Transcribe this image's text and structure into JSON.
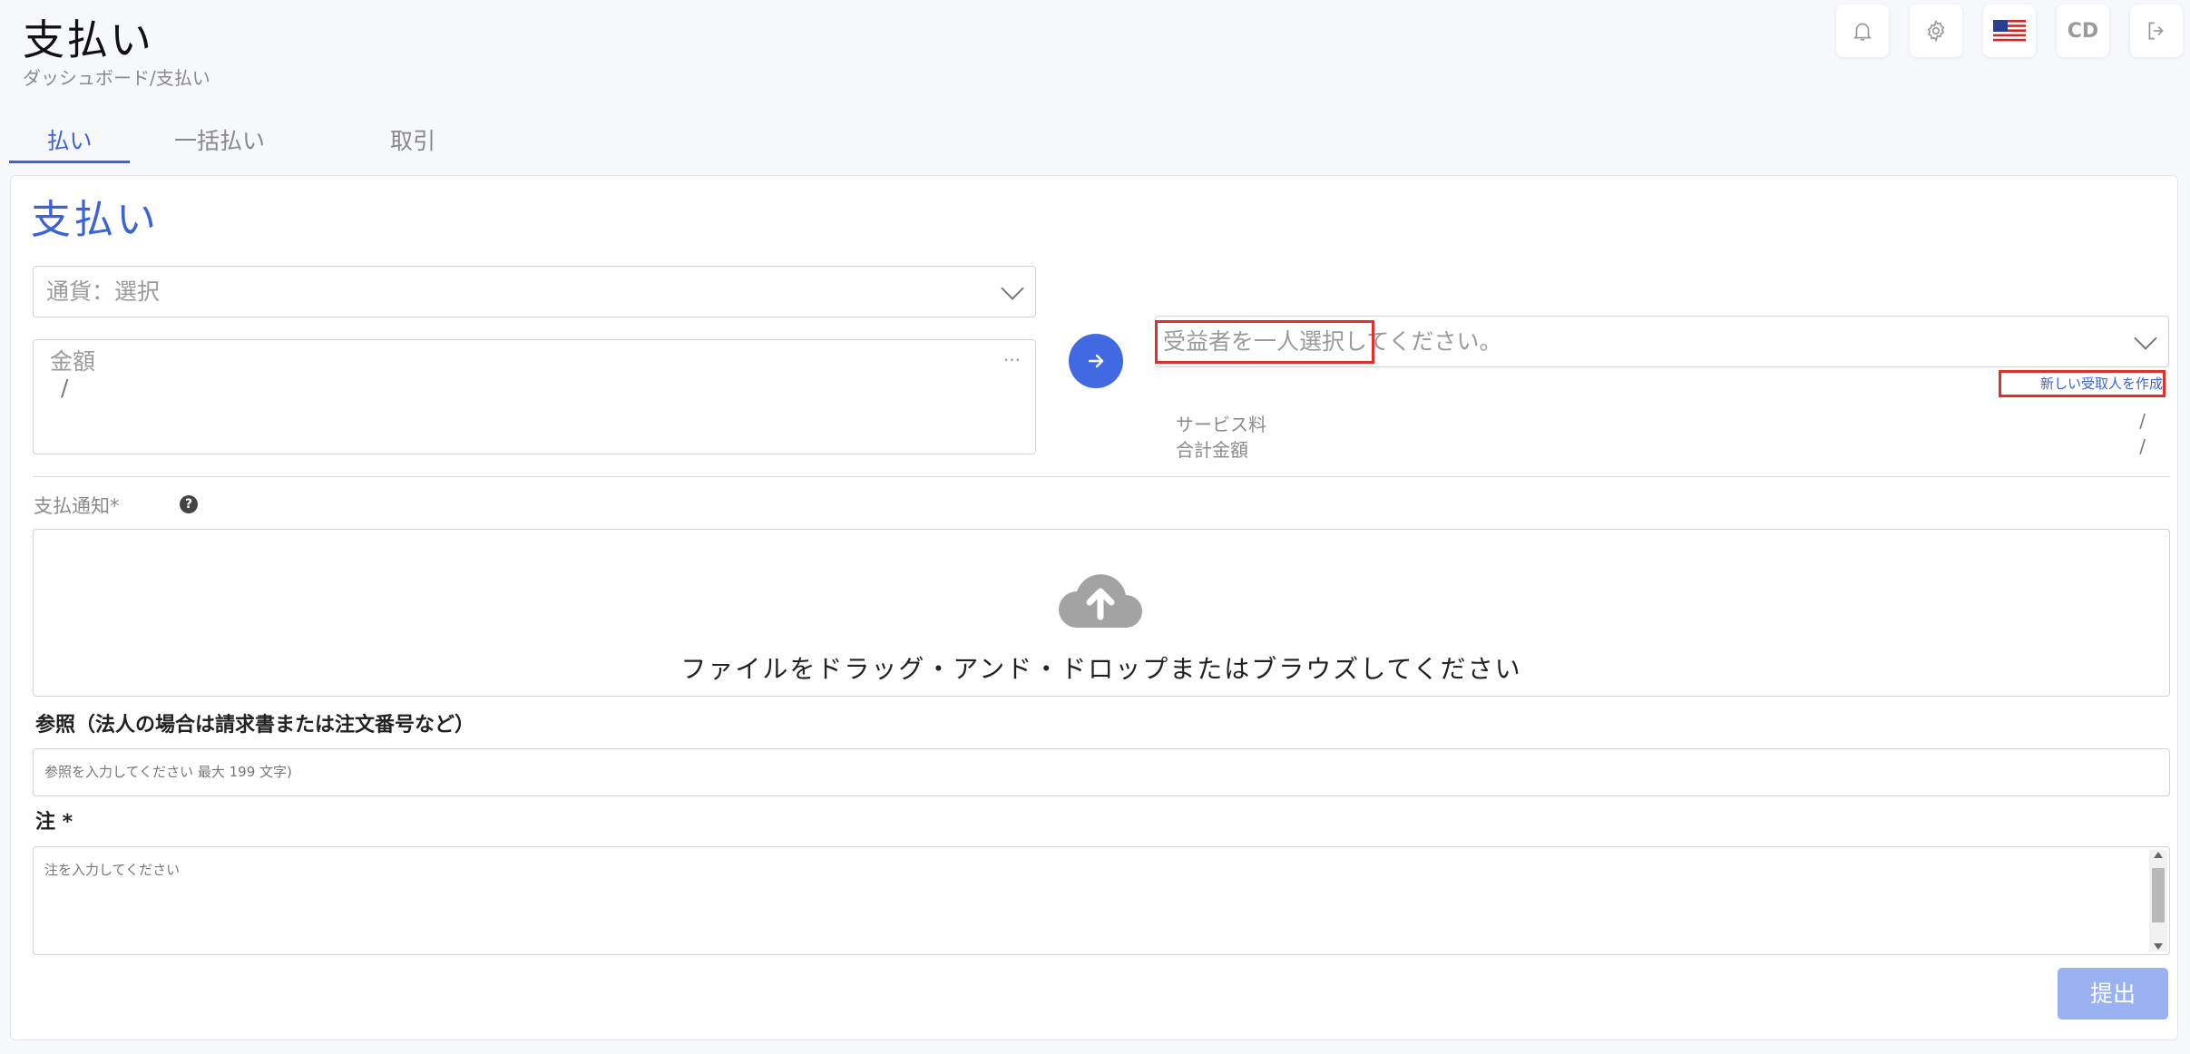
{
  "header": {
    "title": "支払い",
    "breadcrumb": "ダッシュボード/支払い",
    "user_initials": "CD"
  },
  "icons": {
    "notification": "bell-icon",
    "settings": "gear-icon",
    "language": "us-flag-icon",
    "logout": "logout-icon",
    "arrow": "arrow-right-icon",
    "upload": "cloud-upload-icon",
    "help": "question-icon"
  },
  "tabs": [
    {
      "label": "払い",
      "active": true
    },
    {
      "label": "一括払い",
      "active": false
    },
    {
      "label": "取引",
      "active": false
    }
  ],
  "form": {
    "title": "支払い",
    "currency_placeholder": "通貨：選択",
    "amount_label": "金額",
    "amount_value": "/",
    "amount_dots": "...",
    "beneficiary_placeholder": "受益者を一人選択してください。",
    "new_recipient_link": "新しい受取人を作成",
    "service_fee_label": "サービス料",
    "service_fee_value": "/",
    "total_label": "合計金額",
    "total_value": "/",
    "payment_notice_label": "支払通知*",
    "help_glyph": "?",
    "dropzone_text": "ファイルをドラッグ・アンド・ドロップまたはブラウズしてください",
    "reference_label": "参照（法人の場合は請求書または注文番号など）",
    "reference_placeholder": "参照を入力してください 最大 199 文字)",
    "note_label": "注 *",
    "note_placeholder": "注を入力してください",
    "submit_label": "提出"
  },
  "colors": {
    "accent": "#3b63d8",
    "arrow_button": "#4169e1",
    "submit_disabled": "#9bb2f2",
    "highlight": "#e0302a"
  }
}
